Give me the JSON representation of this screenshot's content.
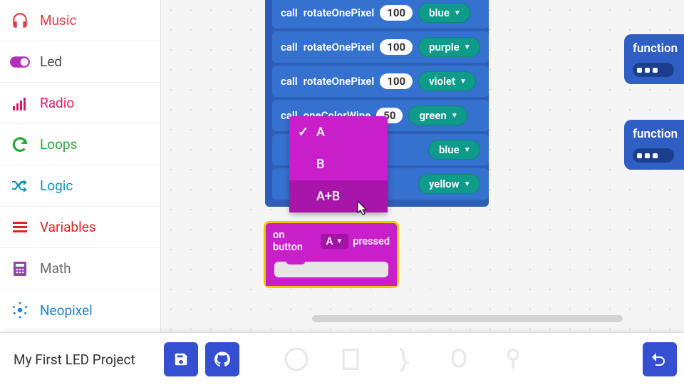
{
  "sidebar": {
    "items": [
      {
        "label": "Music",
        "color": "#e63946"
      },
      {
        "label": "Led",
        "color": "#4a4a4a"
      },
      {
        "label": "Radio",
        "color": "#d11f6b"
      },
      {
        "label": "Loops",
        "color": "#2aa63a"
      },
      {
        "label": "Logic",
        "color": "#1893b6"
      },
      {
        "label": "Variables",
        "color": "#e02222"
      },
      {
        "label": "Math",
        "color": "#6a6a6a"
      },
      {
        "label": "Neopixel",
        "color": "#1c84d6"
      }
    ]
  },
  "stack": {
    "call_label_prefix": "call",
    "blocks": [
      {
        "fn": "rotateOnePixel",
        "arg": "100",
        "color": "blue"
      },
      {
        "fn": "rotateOnePixel",
        "arg": "100",
        "color": "purple"
      },
      {
        "fn": "rotateOnePixel",
        "arg": "100",
        "color": "violet"
      },
      {
        "fn": "oneColorWipe",
        "arg": "50",
        "color": "green"
      },
      {
        "fn": "",
        "arg": "",
        "color": "blue"
      },
      {
        "fn": "",
        "arg": "",
        "color": "yellow"
      }
    ]
  },
  "dropdown": {
    "options": [
      {
        "label": "A",
        "selected": true,
        "hovered": false
      },
      {
        "label": "B",
        "selected": false,
        "hovered": false
      },
      {
        "label": "A+B",
        "selected": false,
        "hovered": true
      }
    ]
  },
  "event_block": {
    "prefix": "on button",
    "value": "A",
    "suffix": "pressed"
  },
  "fn_blocks": {
    "label": "function"
  },
  "bottom_bar": {
    "project_name": "My First LED Project"
  }
}
